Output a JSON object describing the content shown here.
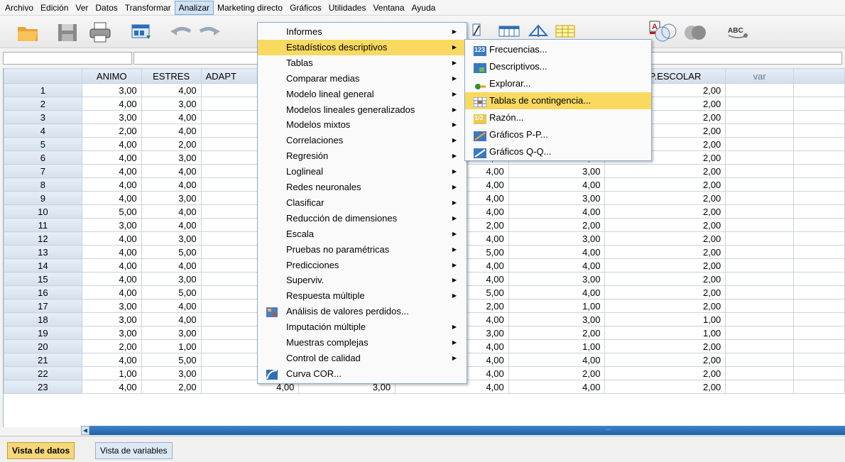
{
  "menubar": {
    "items": [
      {
        "label": "Archivo"
      },
      {
        "label": "Edición"
      },
      {
        "label": "Ver"
      },
      {
        "label": "Datos"
      },
      {
        "label": "Transformar"
      },
      {
        "label": "Analizar"
      },
      {
        "label": "Marketing directo"
      },
      {
        "label": "Gráficos"
      },
      {
        "label": "Utilidades"
      },
      {
        "label": "Ventana"
      },
      {
        "label": "Ayuda"
      }
    ]
  },
  "toolbar": {
    "icons": [
      "open-folder-icon",
      "save-icon",
      "print-icon",
      "dialog-recall-icon",
      "undo-icon",
      "redo-icon",
      "goto-case-icon",
      "variables-icon",
      "split-file-icon",
      "weight-cases-icon",
      "value-labels-icon",
      "use-sets-icon",
      "show-all-variables-icon",
      "spell-check-icon"
    ],
    "spellcheck_text": "ABC"
  },
  "grid": {
    "columns": [
      "",
      "ANIMO",
      "ESTRES",
      "ADAPT",
      "",
      "",
      "",
      "SEMP.ESCOLAR",
      "var"
    ],
    "rows": [
      {
        "n": "1",
        "c": [
          "3,00",
          "4,00",
          "",
          "",
          "",
          "",
          "2,00"
        ]
      },
      {
        "n": "2",
        "c": [
          "4,00",
          "3,00",
          "",
          "",
          "",
          "",
          "2,00"
        ]
      },
      {
        "n": "3",
        "c": [
          "3,00",
          "4,00",
          "",
          "",
          "",
          "",
          "2,00"
        ]
      },
      {
        "n": "4",
        "c": [
          "2,00",
          "4,00",
          "",
          "",
          "",
          "",
          "2,00"
        ]
      },
      {
        "n": "5",
        "c": [
          "4,00",
          "2,00",
          "",
          "",
          "",
          "",
          "2,00"
        ]
      },
      {
        "n": "6",
        "c": [
          "4,00",
          "3,00",
          "",
          "",
          "4,00",
          "4,00",
          "2,00"
        ]
      },
      {
        "n": "7",
        "c": [
          "4,00",
          "4,00",
          "",
          "",
          "4,00",
          "3,00",
          "2,00"
        ]
      },
      {
        "n": "8",
        "c": [
          "4,00",
          "4,00",
          "",
          "",
          "4,00",
          "4,00",
          "2,00"
        ]
      },
      {
        "n": "9",
        "c": [
          "4,00",
          "3,00",
          "",
          "",
          "4,00",
          "3,00",
          "2,00"
        ]
      },
      {
        "n": "10",
        "c": [
          "5,00",
          "4,00",
          "",
          "",
          "4,00",
          "4,00",
          "2,00"
        ]
      },
      {
        "n": "11",
        "c": [
          "3,00",
          "4,00",
          "",
          "",
          "2,00",
          "2,00",
          "2,00"
        ]
      },
      {
        "n": "12",
        "c": [
          "4,00",
          "3,00",
          "",
          "",
          "4,00",
          "3,00",
          "2,00"
        ]
      },
      {
        "n": "13",
        "c": [
          "4,00",
          "5,00",
          "",
          "",
          "5,00",
          "4,00",
          "2,00"
        ]
      },
      {
        "n": "14",
        "c": [
          "4,00",
          "4,00",
          "",
          "",
          "4,00",
          "4,00",
          "2,00"
        ]
      },
      {
        "n": "15",
        "c": [
          "4,00",
          "3,00",
          "",
          "",
          "4,00",
          "3,00",
          "2,00"
        ]
      },
      {
        "n": "16",
        "c": [
          "4,00",
          "5,00",
          "",
          "",
          "5,00",
          "4,00",
          "2,00"
        ]
      },
      {
        "n": "17",
        "c": [
          "3,00",
          "4,00",
          "",
          "",
          "2,00",
          "1,00",
          "2,00"
        ]
      },
      {
        "n": "18",
        "c": [
          "3,00",
          "4,00",
          "",
          "",
          "4,00",
          "3,00",
          "1,00"
        ]
      },
      {
        "n": "19",
        "c": [
          "3,00",
          "3,00",
          "",
          "",
          "3,00",
          "2,00",
          "1,00"
        ]
      },
      {
        "n": "20",
        "c": [
          "2,00",
          "1,00",
          "",
          "",
          "4,00",
          "1,00",
          "2,00"
        ]
      },
      {
        "n": "21",
        "c": [
          "4,00",
          "5,00",
          "5,00",
          "4,00",
          "4,00",
          "4,00",
          "2,00"
        ]
      },
      {
        "n": "22",
        "c": [
          "1,00",
          "3,00",
          "3,00",
          "1,00",
          "4,00",
          "2,00",
          "2,00"
        ]
      },
      {
        "n": "23",
        "c": [
          "4,00",
          "2,00",
          "4,00",
          "3,00",
          "4,00",
          "4,00",
          "2,00"
        ]
      }
    ]
  },
  "analizar_menu": {
    "items": [
      {
        "label": "Informes",
        "arrow": "▶"
      },
      {
        "label": "Estadísticos descriptivos",
        "arrow": "▶"
      },
      {
        "label": "Tablas",
        "arrow": "▶"
      },
      {
        "label": "Comparar medias",
        "arrow": "▶"
      },
      {
        "label": "Modelo lineal general",
        "arrow": "▶"
      },
      {
        "label": "Modelos lineales generalizados",
        "arrow": "▶"
      },
      {
        "label": "Modelos mixtos",
        "arrow": "▶"
      },
      {
        "label": "Correlaciones",
        "arrow": "▶"
      },
      {
        "label": "Regresión",
        "arrow": "▶"
      },
      {
        "label": "Loglineal",
        "arrow": "▶"
      },
      {
        "label": "Redes neuronales",
        "arrow": "▶"
      },
      {
        "label": "Clasificar",
        "arrow": "▶"
      },
      {
        "label": "Reducción de dimensiones",
        "arrow": "▶"
      },
      {
        "label": "Escala",
        "arrow": "▶"
      },
      {
        "label": "Pruebas no paramétricas",
        "arrow": "▶"
      },
      {
        "label": "Predicciones",
        "arrow": "▶"
      },
      {
        "label": "Superviv.",
        "arrow": "▶"
      },
      {
        "label": "Respuesta múltiple",
        "arrow": "▶"
      },
      {
        "label": "Análisis de valores perdidos...",
        "arrow": ""
      },
      {
        "label": "Imputación múltiple",
        "arrow": "▶"
      },
      {
        "label": "Muestras complejas",
        "arrow": "▶"
      },
      {
        "label": "Control de calidad",
        "arrow": "▶"
      },
      {
        "label": "Curva COR...",
        "arrow": ""
      }
    ]
  },
  "descriptivos_submenu": {
    "items": [
      {
        "label": "Frecuencias...",
        "icon_text": "123"
      },
      {
        "label": "Descriptivos...",
        "icon_text": ""
      },
      {
        "label": "Explorar...",
        "icon_text": ""
      },
      {
        "label": "Tablas de contingencia...",
        "icon_text": ""
      },
      {
        "label": "Razón...",
        "icon_text": "1/2"
      },
      {
        "label": "Gráficos P-P...",
        "icon_text": ""
      },
      {
        "label": "Gráficos Q-Q...",
        "icon_text": ""
      }
    ]
  },
  "tabs": {
    "data_view": "Vista de datos",
    "variable_view": "Vista de variables"
  },
  "colors": {
    "highlight": "#f9d960",
    "menu_active": "#cfe1f4",
    "scrollbar": "#2a6fb5"
  }
}
